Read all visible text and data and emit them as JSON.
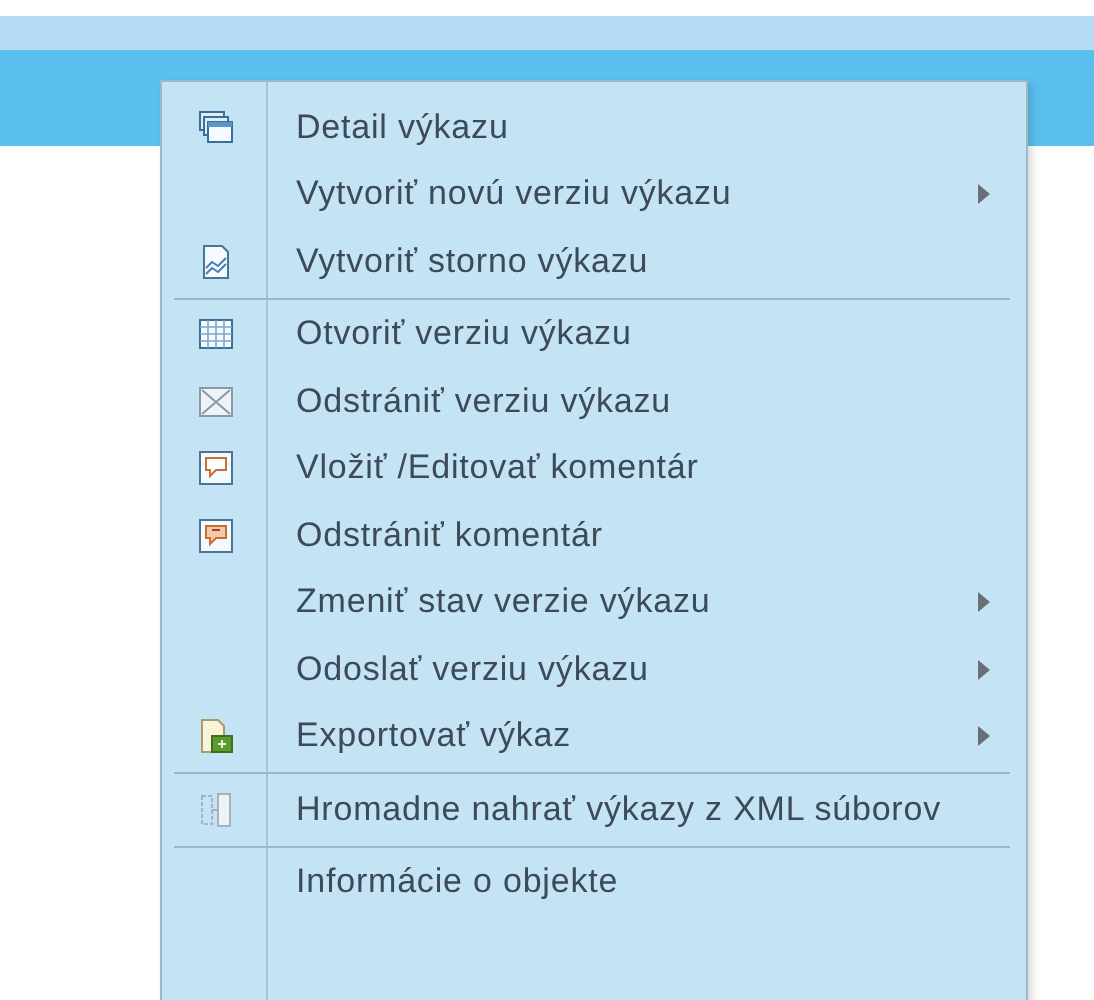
{
  "menu": {
    "items": [
      {
        "label": "Detail výkazu",
        "kind": "windows",
        "submenu": false,
        "separator_before": false
      },
      {
        "label": "Vytvoriť novú verziu výkazu",
        "submenu": true,
        "separator_before": false
      },
      {
        "label": "Vytvoriť storno výkazu",
        "kind": "chart",
        "submenu": false,
        "separator_before": false
      },
      {
        "label": "Otvoriť verziu výkazu",
        "kind": "grid",
        "submenu": false,
        "separator_before": true
      },
      {
        "label": "Odstrániť verziu výkazu",
        "kind": "cross",
        "submenu": false,
        "separator_before": false
      },
      {
        "label": "Vložiť /Editovať komentár",
        "kind": "comment",
        "submenu": false,
        "separator_before": false
      },
      {
        "label": "Odstrániť komentár",
        "kind": "comment-remove",
        "submenu": false,
        "separator_before": false
      },
      {
        "label": "Zmeniť stav verzie výkazu",
        "submenu": true,
        "separator_before": false
      },
      {
        "label": "Odoslať verziu výkazu",
        "submenu": true,
        "separator_before": false
      },
      {
        "label": "Exportovať výkaz",
        "kind": "export",
        "submenu": true,
        "separator_before": false
      },
      {
        "label": "Hromadne nahrať výkazy z XML súborov",
        "kind": "split",
        "submenu": false,
        "separator_before": true
      },
      {
        "label": "Informácie o objekte",
        "submenu": false,
        "separator_before": true
      }
    ]
  }
}
